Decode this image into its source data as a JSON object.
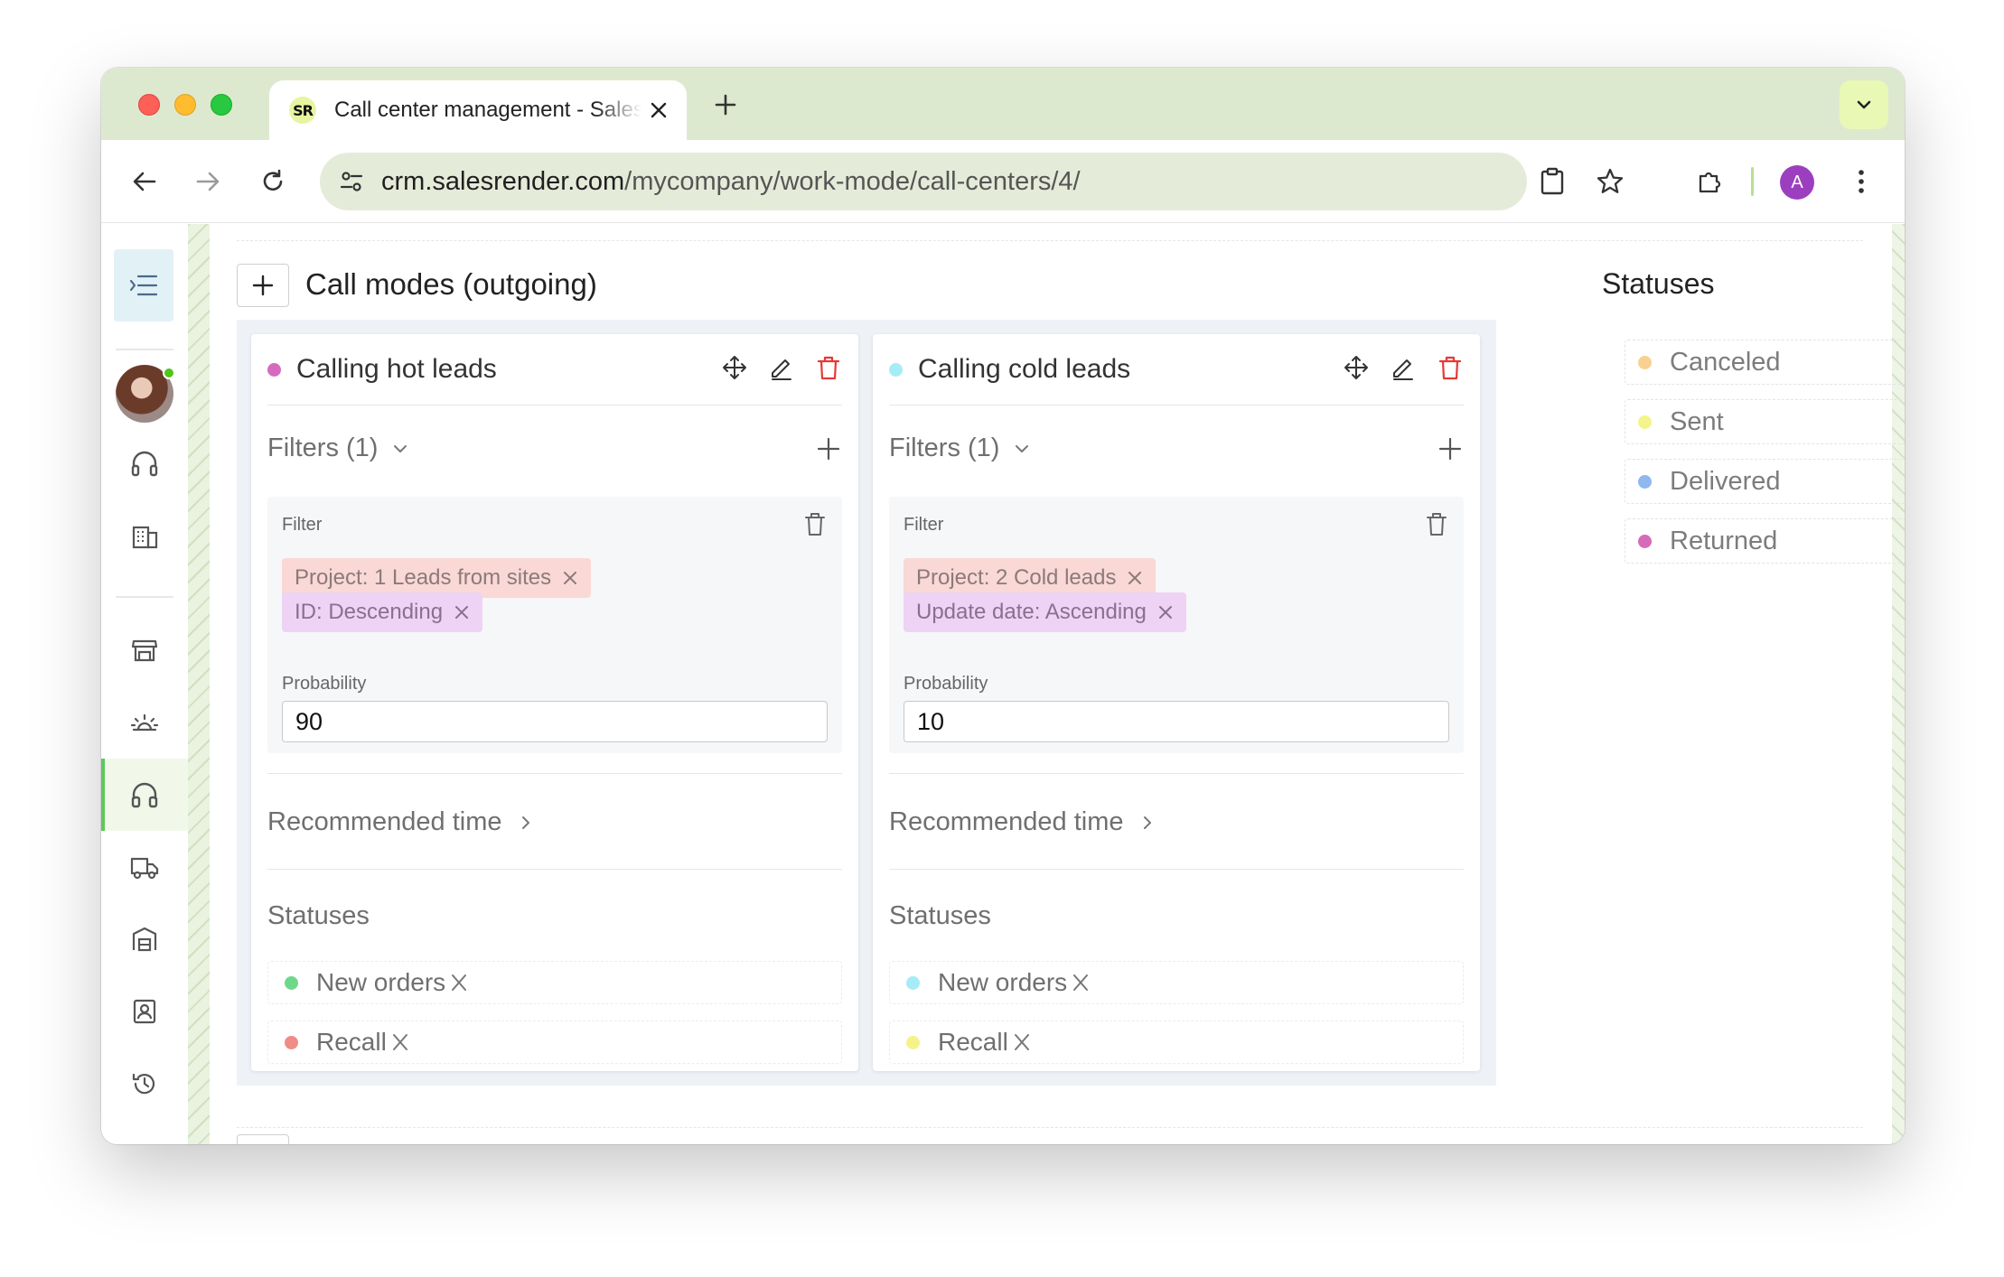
{
  "browser": {
    "tab_favicon": "SR",
    "tab_title": "Call center management - SalesRender",
    "url_host": "crm.salesrender.com",
    "url_path": "/mycompany/work-mode/call-centers/4/",
    "profile_initial": "A",
    "accent_color": "#dde9cf"
  },
  "sidebar": {
    "icons": [
      "menu-icon",
      "headset-icon",
      "building-icon",
      "store-icon",
      "sunrise-icon",
      "headphones-icon",
      "truck-icon",
      "warehouse-icon",
      "contacts-icon",
      "history-icon"
    ],
    "active": "headphones-icon"
  },
  "page": {
    "section_title": "Call modes (outgoing)",
    "statuses_title": "Statuses",
    "statuses": [
      {
        "label": "Canceled",
        "color": "#f7d191"
      },
      {
        "label": "Sent",
        "color": "#f3f58a"
      },
      {
        "label": "Delivered",
        "color": "#8fb8ef"
      },
      {
        "label": "Returned",
        "color": "#d66bb8"
      }
    ]
  },
  "modes": [
    {
      "title": "Calling hot leads",
      "color": "#d46bbf",
      "filters_label": "Filters (1)",
      "filter_label": "Filter",
      "chips": [
        {
          "text": "Project:  1 Leads from sites",
          "kind": "project"
        },
        {
          "text": "ID: Descending",
          "kind": "sort"
        }
      ],
      "probability_label": "Probability",
      "probability_value": "90",
      "recommended_time": "Recommended time",
      "statuses_label": "Statuses",
      "statuses": [
        {
          "label": "New orders",
          "color": "#6ed88a"
        },
        {
          "label": "Recall",
          "color": "#ef8c86"
        }
      ]
    },
    {
      "title": "Calling cold leads",
      "color": "#a6ecf7",
      "filters_label": "Filters (1)",
      "filter_label": "Filter",
      "chips": [
        {
          "text": "Project:  2 Cold leads",
          "kind": "project"
        },
        {
          "text": "Update date: Ascending",
          "kind": "sort"
        }
      ],
      "probability_label": "Probability",
      "probability_value": "10",
      "recommended_time": "Recommended time",
      "statuses_label": "Statuses",
      "statuses": [
        {
          "label": "New orders",
          "color": "#a6ecf7"
        },
        {
          "label": "Recall",
          "color": "#f5f28a"
        }
      ]
    }
  ]
}
